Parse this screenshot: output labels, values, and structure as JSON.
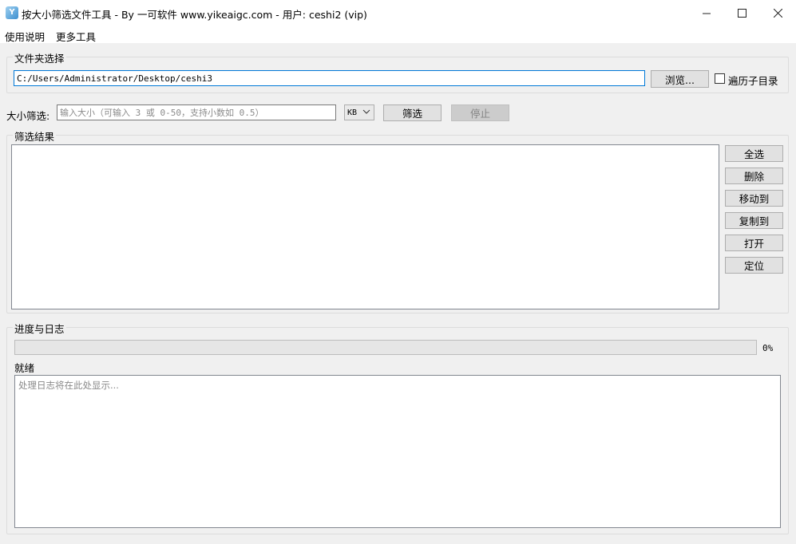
{
  "window": {
    "title": "按大小筛选文件工具 - By 一可软件 www.yikeaigc.com - 用户: ceshi2 (vip)",
    "app_icon_glyph": "Y"
  },
  "menu": {
    "items": [
      "使用说明",
      "更多工具"
    ]
  },
  "folder_group": {
    "label": "文件夹选择",
    "path_value": "C:/Users/Administrator/Desktop/ceshi3",
    "browse_label": "浏览...",
    "subdirs_label": "遍历子目录",
    "subdirs_checked": false
  },
  "size_filter": {
    "label": "大小筛选:",
    "placeholder": "输入大小（可输入 3 或 0-50，支持小数如 0.5）",
    "unit_selected": "KB",
    "filter_label": "筛选",
    "stop_label": "停止"
  },
  "results_group": {
    "label": "筛选结果",
    "buttons": [
      "全选",
      "删除",
      "移动到",
      "复制到",
      "打开",
      "定位"
    ]
  },
  "progress_group": {
    "label": "进度与日志",
    "progress_percent_text": "0%",
    "progress_fraction": 0,
    "status_text": "就绪",
    "log_placeholder": "处理日志将在此处显示..."
  },
  "colors": {
    "accent_focus": "#0078d7",
    "button_face": "#e1e1e1",
    "window_bg": "#f0f0f0"
  }
}
